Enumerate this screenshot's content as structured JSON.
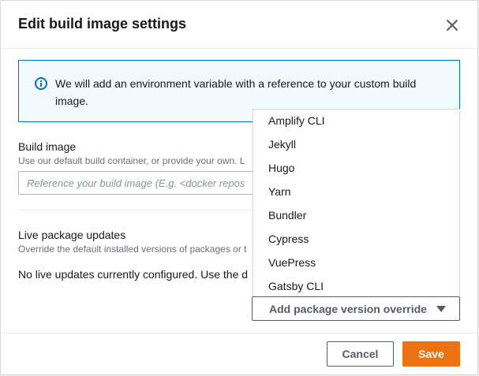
{
  "modal": {
    "title": "Edit build image settings",
    "close_icon": "close-icon"
  },
  "info": {
    "icon": "info-icon",
    "text": "We will add an environment variable with a reference to your custom build image."
  },
  "build_image": {
    "label": "Build image",
    "description": "Use our default build container, or provide your own. L",
    "placeholder": "Reference your build image (E.g. <docker repos"
  },
  "live_updates": {
    "label": "Live package updates",
    "description": "Override the default installed versions of packages or t",
    "empty_text": "No live updates currently configured. Use the d"
  },
  "dropdown": {
    "items": [
      "Amplify CLI",
      "Jekyll",
      "Hugo",
      "Yarn",
      "Bundler",
      "Cypress",
      "VuePress",
      "Gatsby CLI"
    ],
    "button_label": "Add package version override",
    "caret_icon": "caret-down-icon"
  },
  "footer": {
    "cancel_label": "Cancel",
    "save_label": "Save"
  },
  "colors": {
    "accent": "#ec7211",
    "info_border": "#0073bb",
    "info_bg": "#f1faff"
  }
}
